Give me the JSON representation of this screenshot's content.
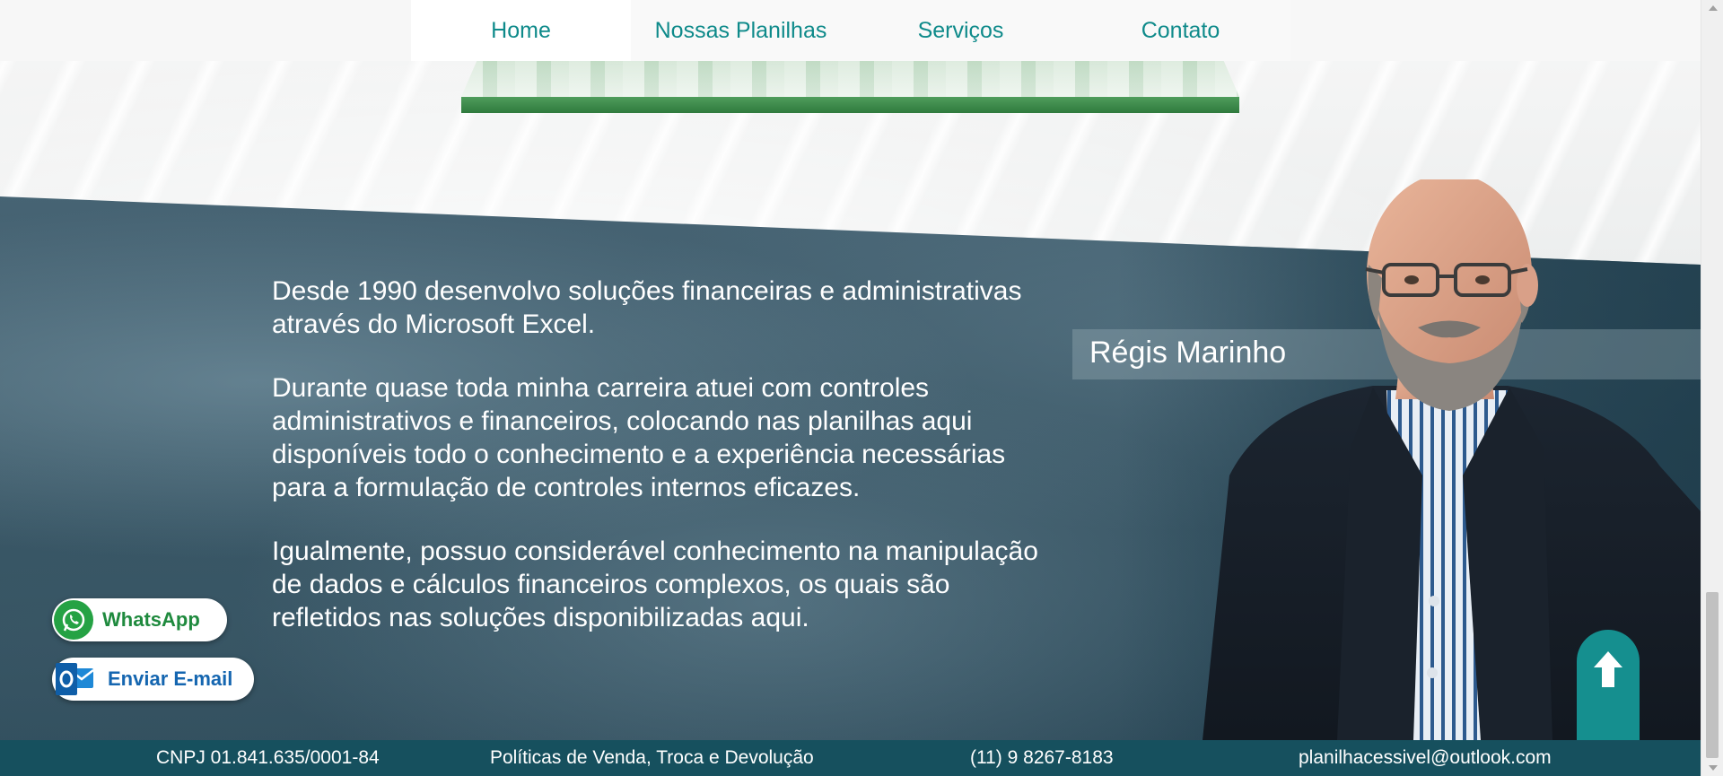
{
  "nav": {
    "items": [
      {
        "label": "Home"
      },
      {
        "label": "Nossas Planilhas"
      },
      {
        "label": "Serviços"
      },
      {
        "label": "Contato"
      }
    ]
  },
  "about": {
    "paragraphs": [
      "Desde 1990 desenvolvo soluções financeiras e administrativas através do Microsoft Excel.",
      "Durante quase toda minha carreira atuei com controles administrativos e financeiros, colocando nas planilhas aqui disponíveis todo o conhecimento e a experiência necessárias para a formulação de controles internos eficazes.",
      "Igualmente, possuo considerável conhecimento na manipulação de dados e cálculos financeiros complexos, os quais são refletidos nas soluções disponibilizadas aqui."
    ],
    "name": "Régis Marinho"
  },
  "floating": {
    "whatsapp_label": "WhatsApp",
    "email_label": "Enviar E-mail"
  },
  "footer": {
    "cnpj": "CNPJ 01.841.635/0001-84",
    "policy": "Políticas de Venda, Troca e Devolução",
    "phone": "(11) 9 8267-8183",
    "email": "planilhacessivel@outlook.com"
  },
  "colors": {
    "accent": "#0e8a8a",
    "footer": "#16505e",
    "whatsapp": "#25a244",
    "outlook": "#1566b0"
  }
}
